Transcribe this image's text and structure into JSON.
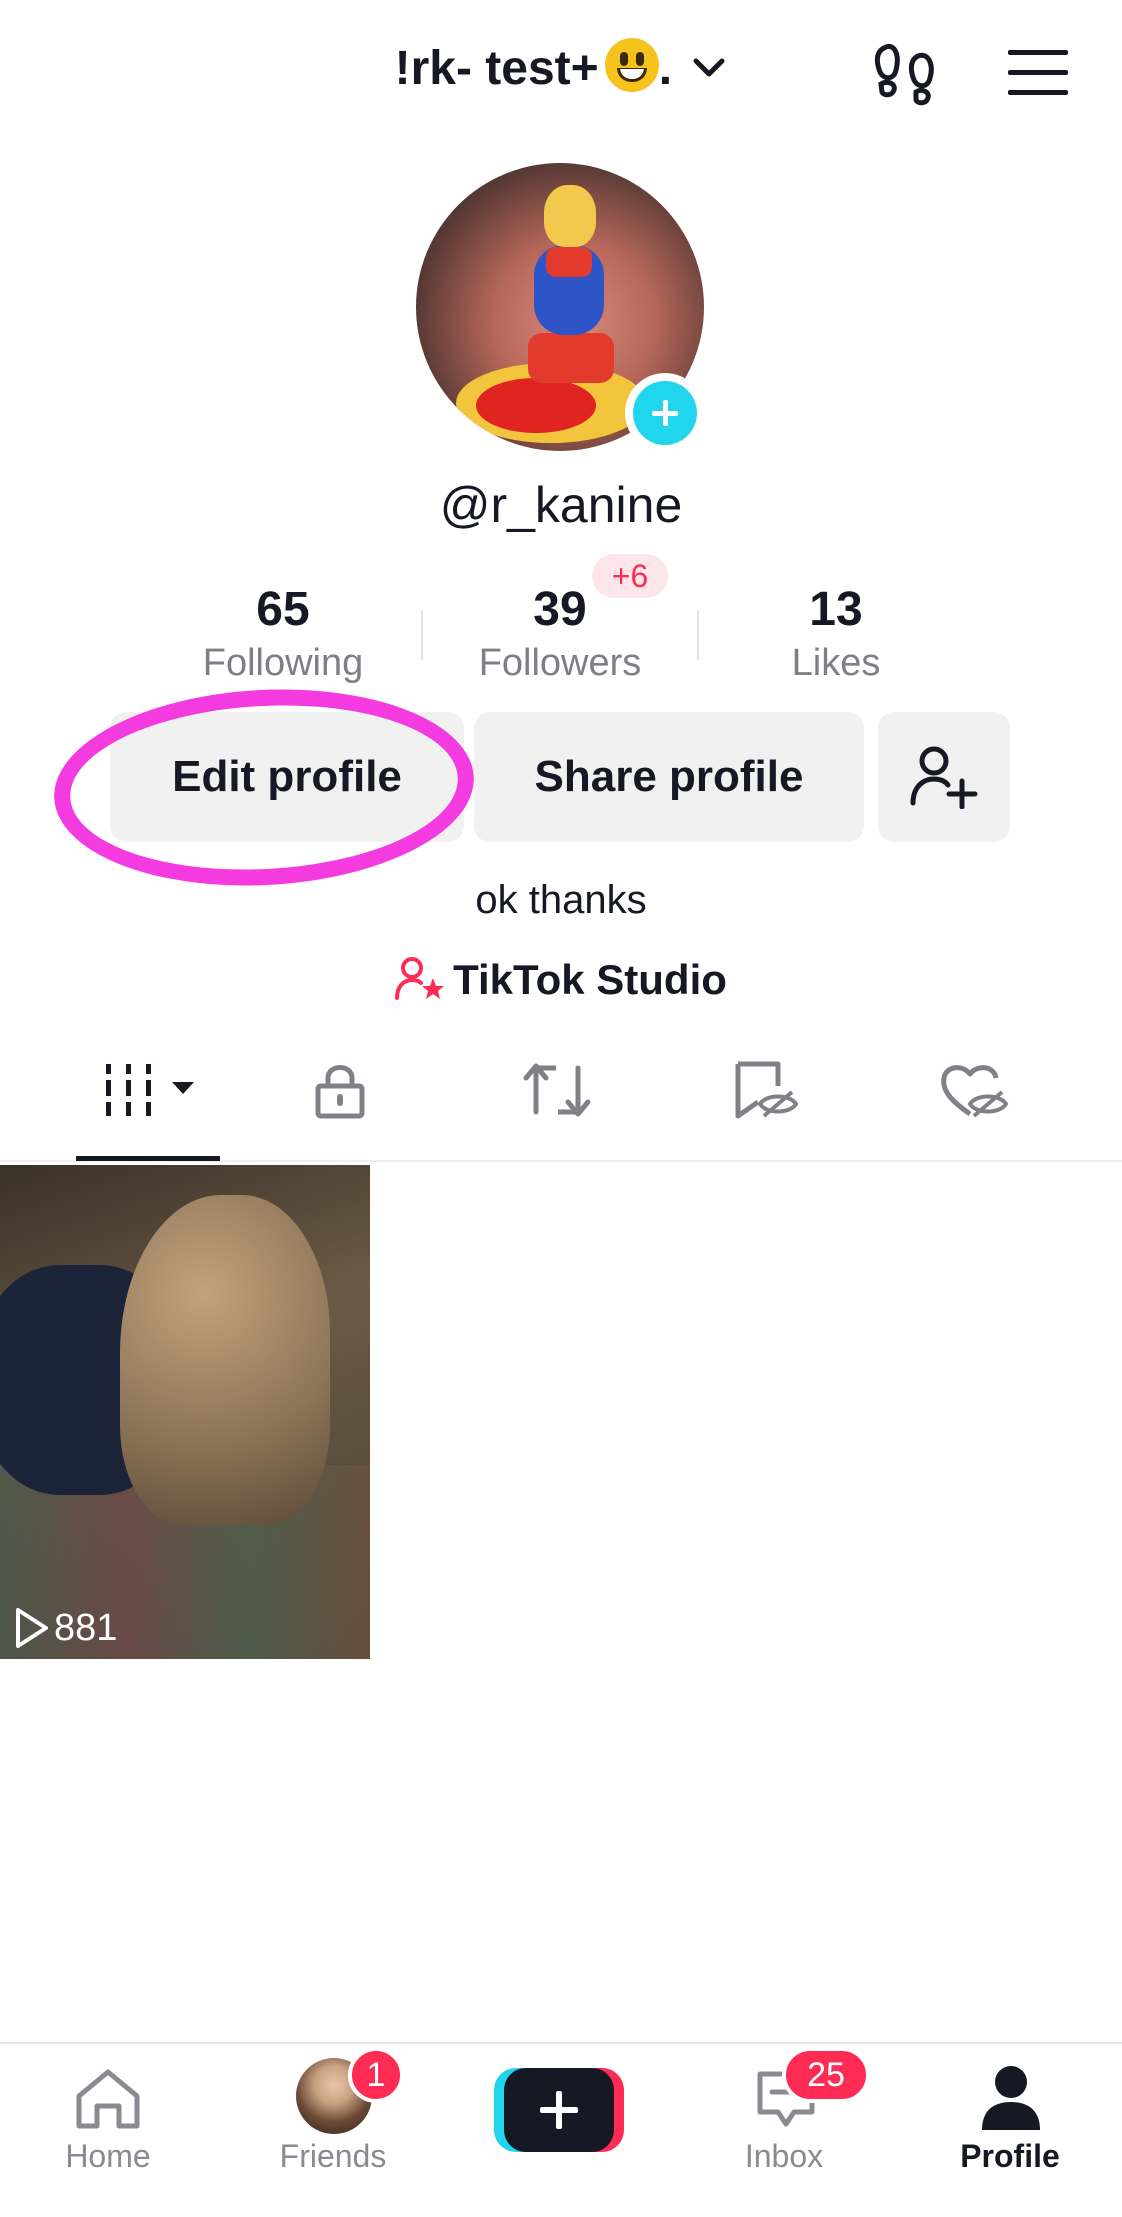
{
  "header": {
    "account_name": "!rk- test+",
    "account_suffix": ".",
    "emoji": "grinning-face-emoji"
  },
  "profile": {
    "username": "@r_kanine",
    "bio": "ok thanks",
    "studio_link": "TikTok Studio"
  },
  "stats": {
    "following": {
      "value": "65",
      "label": "Following"
    },
    "followers": {
      "value": "39",
      "label": "Followers",
      "new_badge": "+6"
    },
    "likes": {
      "value": "13",
      "label": "Likes"
    }
  },
  "actions": {
    "edit_profile": "Edit profile",
    "share_profile": "Share profile",
    "add_friend_icon": "add-user-icon"
  },
  "content_tabs": [
    {
      "icon": "grid-icon",
      "selected": true
    },
    {
      "icon": "lock-icon",
      "selected": false
    },
    {
      "icon": "repost-icon",
      "selected": false
    },
    {
      "icon": "bookmark-hidden-icon",
      "selected": false
    },
    {
      "icon": "heart-hidden-icon",
      "selected": false
    }
  ],
  "videos": [
    {
      "views": "881"
    }
  ],
  "bottom_nav": {
    "home": "Home",
    "friends": "Friends",
    "friends_badge": "1",
    "create": "create-plus-icon",
    "inbox": "Inbox",
    "inbox_badge": "25",
    "profile": "Profile"
  },
  "colors": {
    "accent_red": "#fe2c55",
    "accent_cyan": "#20d5ec",
    "annotation_magenta": "#f43be0"
  }
}
